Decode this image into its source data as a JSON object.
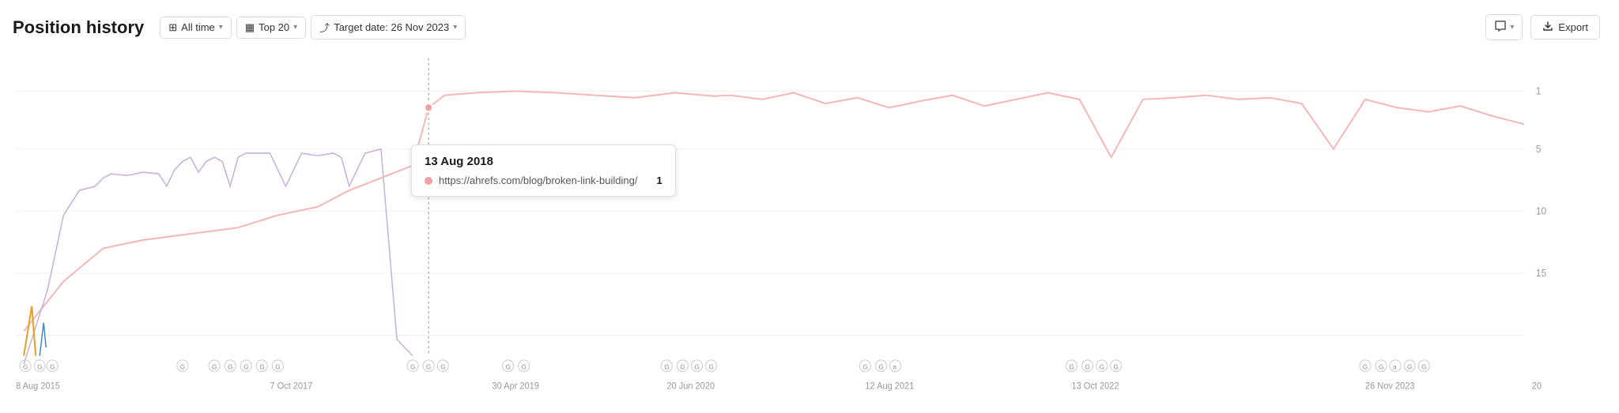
{
  "header": {
    "title": "Position history",
    "controls": [
      {
        "id": "time-range",
        "icon": "calendar",
        "label": "All time",
        "has_chevron": true
      },
      {
        "id": "top-filter",
        "icon": "table",
        "label": "Top 20",
        "has_chevron": true
      },
      {
        "id": "target-date",
        "icon": "trend",
        "label": "Target date: 26 Nov 2023",
        "has_chevron": true
      }
    ],
    "right_controls": [
      {
        "id": "comment",
        "icon": "💬",
        "has_chevron": true
      },
      {
        "id": "export",
        "icon": "export",
        "label": "Export"
      }
    ]
  },
  "tooltip": {
    "date": "13 Aug 2018",
    "row": {
      "url": "https://ahrefs.com/blog/broken-link-building/",
      "value": "1"
    }
  },
  "chart": {
    "y_labels": [
      "1",
      "5",
      "10",
      "15"
    ],
    "x_labels": [
      "8 Aug 2015",
      "7 Oct 2017",
      "30 Apr 2019",
      "20 Jun 2020",
      "12 Aug 2021",
      "13 Oct 2022",
      "26 Nov 2023",
      "20"
    ]
  }
}
